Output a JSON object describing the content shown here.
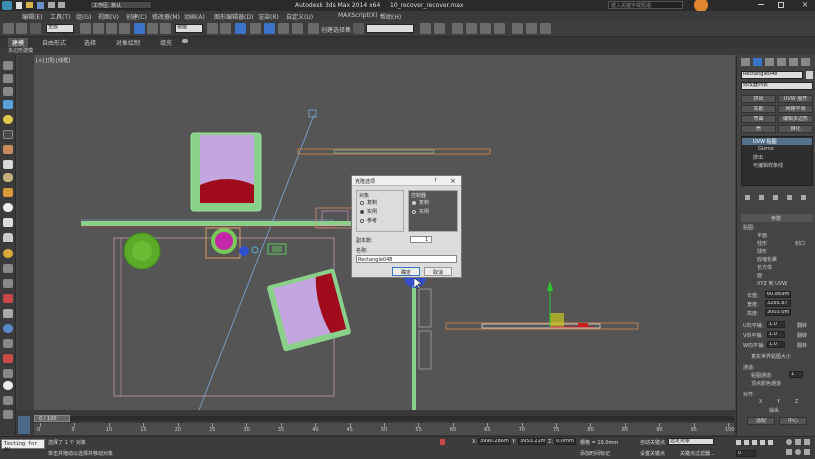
{
  "titlebar": {
    "app_title": "Autodesk 3ds Max  2014 x64",
    "file_name": "10_recover_recover.max",
    "workspace_label": "工作区: 默认",
    "search_placeholder": "键入关键字或短语"
  },
  "menu": [
    "编辑(E)",
    "工具(T)",
    "组(G)",
    "视图(V)",
    "创建(C)",
    "修改器(M)",
    "动画(A)",
    "图形编辑器(D)",
    "渲染(R)",
    "自定义(U)",
    "MAXScript(X)",
    "帮助(H)"
  ],
  "toolbar": {
    "selection_filter": "全部",
    "view_dropdown": "视图",
    "named_selection": "创建选择集"
  },
  "ribbon": {
    "tabs": [
      "建模",
      "自由形式",
      "选择",
      "对象绘制",
      "填充"
    ],
    "subtab": "多边形建模"
  },
  "viewport": {
    "label": "[+] [顶] [线框]"
  },
  "dialog": {
    "title": "克隆选项",
    "help": "?",
    "close": "×",
    "object_group_label": "对象",
    "object_options": [
      "复制",
      "实例",
      "参考"
    ],
    "controller_group_label": "控制器",
    "controller_options": [
      "复制",
      "实例"
    ],
    "copies_label": "副本数:",
    "copies_value": "1",
    "name_label": "名称:",
    "name_value": "Rectangle048",
    "ok_label": "确定",
    "cancel_label": "取消"
  },
  "right_panel": {
    "object_name": "Rectangle048",
    "modifier_list": "修改器列表",
    "buttons": [
      "挤出",
      "UVW 展开",
      "车削",
      "网格平滑",
      "弯曲",
      "编辑多边形",
      "壳",
      "锥化",
      "FFD",
      "晶格"
    ],
    "stack": [
      "UVW 贴图",
      "Gizmo",
      "挤出",
      "可编辑样条线"
    ],
    "params_title": "参数",
    "mapping_label": "贴图:",
    "mapping_options": [
      "平面",
      "柱形",
      "封口",
      "球形",
      "收缩包裹",
      "长方体",
      "面",
      "XYZ 到 UVW"
    ],
    "length_label": "长度:",
    "length_value": "60.869m",
    "width_label": "宽度:",
    "width_value": "3265.87",
    "height_label": "高度:",
    "height_value": "3003.0m",
    "u_tile_label": "U向平铺:",
    "u_tile_value": "1.0",
    "v_tile_label": "V向平铺:",
    "v_tile_value": "1.0",
    "w_tile_label": "W向平铺:",
    "w_tile_value": "1.0",
    "flip_label": "翻转",
    "realworld_label": "真实世界贴图大小",
    "channel_title": "通道:",
    "channel_map": "贴图通道:",
    "channel_value": "1",
    "vertex_color": "顶点颜色通道",
    "align_title": "对齐:",
    "align_axes": [
      "X",
      "Y",
      "Z"
    ],
    "manipulate": "操纵",
    "fit": "适配",
    "center": "中心"
  },
  "timeline": {
    "frame_display": "0 / 100",
    "ticks": [
      "0",
      "5",
      "10",
      "15",
      "20",
      "25",
      "30",
      "35",
      "40",
      "45",
      "50",
      "55",
      "60",
      "65",
      "70",
      "75",
      "80",
      "85",
      "90",
      "95",
      "100"
    ]
  },
  "status": {
    "selection": "选择了 1 个 对象",
    "hint": "单击并拖动以选择并移动对象",
    "x_label": "X:",
    "x_value": "3990.286m",
    "y_label": "Y:",
    "y_value": "3953.21m",
    "z_label": "Z:",
    "z_value": "0.0mm",
    "grid": "栅格 = 10.0mm",
    "autokey": "自动关键点",
    "selected_obj": "选定对象",
    "setkey": "设置关键点",
    "keyfilter": "关键点过滤器...",
    "add_time_tag": "添加时间标记",
    "frame": "0",
    "testing": "Testing for AU"
  }
}
